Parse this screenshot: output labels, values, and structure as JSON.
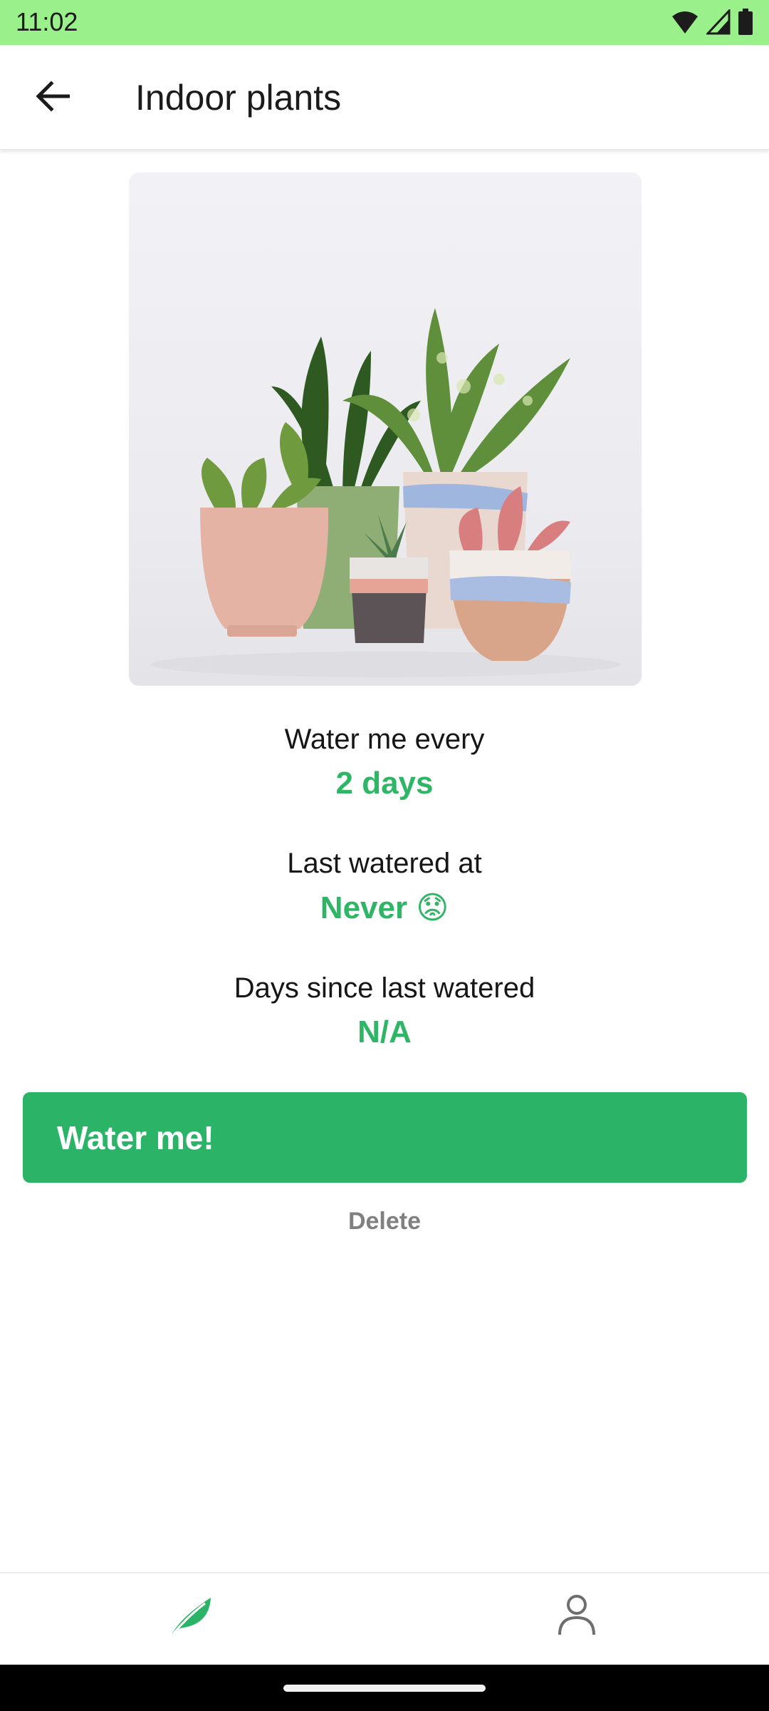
{
  "status_bar": {
    "time": "11:02",
    "icons": [
      "wifi-icon",
      "cellular-signal-icon",
      "battery-icon"
    ]
  },
  "app_bar": {
    "back_icon": "arrow-left-icon",
    "title": "Indoor plants"
  },
  "plant": {
    "image": "potted-plants-photo",
    "water_frequency_label": "Water me every",
    "water_frequency_value": "2 days",
    "last_watered_label": "Last watered at",
    "last_watered_value": "Never 😟",
    "days_since_label": "Days since last watered",
    "days_since_value": "N/A"
  },
  "actions": {
    "water_label": "Water me!",
    "delete_label": "Delete"
  },
  "bottom_nav": {
    "items": [
      {
        "icon": "leaf-icon",
        "active": true
      },
      {
        "icon": "user-icon",
        "active": false
      }
    ]
  },
  "colors": {
    "accent": "#2bb468",
    "status_bar": "#9af08a",
    "muted": "#808080"
  }
}
